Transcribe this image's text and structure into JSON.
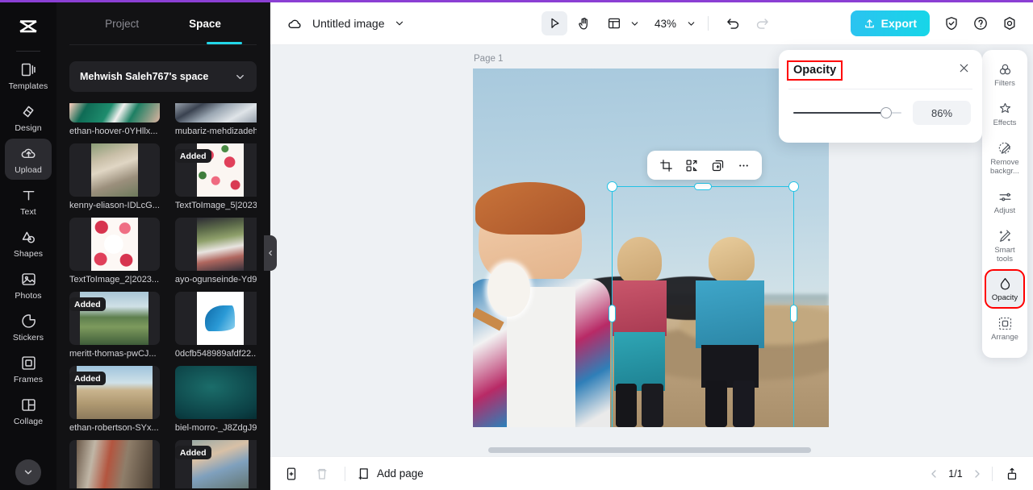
{
  "app": {
    "logo": "capcut-logo",
    "accent": "#23d6e8",
    "highlight": "#ff0000"
  },
  "left_rail": {
    "items": [
      {
        "label": "Templates",
        "icon": "templates-icon",
        "active": false
      },
      {
        "label": "Design",
        "icon": "design-icon",
        "active": false
      },
      {
        "label": "Upload",
        "icon": "upload-cloud-icon",
        "active": true
      },
      {
        "label": "Text",
        "icon": "text-icon",
        "active": false
      },
      {
        "label": "Shapes",
        "icon": "shapes-icon",
        "active": false
      },
      {
        "label": "Photos",
        "icon": "photos-icon",
        "active": false
      },
      {
        "label": "Stickers",
        "icon": "stickers-icon",
        "active": false
      },
      {
        "label": "Frames",
        "icon": "frames-icon",
        "active": false
      },
      {
        "label": "Collage",
        "icon": "collage-icon",
        "active": false
      }
    ],
    "collapse_icon": "chevron-down-icon"
  },
  "panel": {
    "tabs": [
      {
        "label": "Project",
        "active": false
      },
      {
        "label": "Space",
        "active": true
      }
    ],
    "space_select": {
      "value": "Mehwish Saleh767's space",
      "icon": "chevron-down-icon"
    },
    "collapse_icon": "chevron-left-icon",
    "assets": [
      {
        "name": "ethan-hoover-0YHllx...",
        "badge": ""
      },
      {
        "name": "mubariz-mehdizadeh...",
        "badge": ""
      },
      {
        "name": "kenny-eliason-IDLcG...",
        "badge": ""
      },
      {
        "name": "TextToImage_5|2023...",
        "badge": "Added"
      },
      {
        "name": "TextToImage_2|2023...",
        "badge": ""
      },
      {
        "name": "ayo-ogunseinde-Yd9...",
        "badge": ""
      },
      {
        "name": "meritt-thomas-pwCJ...",
        "badge": "Added"
      },
      {
        "name": "0dcfb548989afdf22...",
        "badge": ""
      },
      {
        "name": "ethan-robertson-SYx...",
        "badge": "Added"
      },
      {
        "name": "biel-morro-_J8ZdgJ9...",
        "badge": ""
      },
      {
        "name": "",
        "badge": ""
      },
      {
        "name": "",
        "badge": "Added"
      }
    ]
  },
  "topbar": {
    "cloud_icon": "cloud-icon",
    "doc_title": "Untitled image",
    "title_caret": "chevron-down-icon",
    "tools": [
      {
        "name": "select-tool",
        "icon": "cursor-arrow-icon",
        "selected": true
      },
      {
        "name": "hand-tool",
        "icon": "hand-icon",
        "selected": false
      },
      {
        "name": "layout-tool",
        "icon": "layout-icon",
        "selected": false
      }
    ],
    "zoom": "43%",
    "zoom_caret": "chevron-down-icon",
    "undo_icon": "undo-icon",
    "redo_icon": "redo-icon",
    "export_label": "Export",
    "export_icon": "upload-icon",
    "shield_icon": "shield-check-icon",
    "help_icon": "question-circle-icon",
    "settings_icon": "gear-icon"
  },
  "canvas": {
    "page_label": "Page 1",
    "float_toolbar": [
      {
        "name": "crop-button",
        "icon": "crop-icon"
      },
      {
        "name": "flip-button",
        "icon": "flip-icon"
      },
      {
        "name": "duplicate-button",
        "icon": "duplicate-icon"
      },
      {
        "name": "more-button",
        "icon": "ellipsis-icon"
      }
    ],
    "rotate_icon": "rotate-icon"
  },
  "opacity_popover": {
    "title": "Opacity",
    "close_icon": "close-icon",
    "value": "86%",
    "percent": 86
  },
  "tools_rail": [
    {
      "label": "Filters",
      "icon": "filters-icon",
      "active": false,
      "highlight": false
    },
    {
      "label": "Effects",
      "icon": "effects-icon",
      "active": false,
      "highlight": false
    },
    {
      "label": "Remove backgr...",
      "icon": "remove-background-icon",
      "active": false,
      "highlight": false
    },
    {
      "label": "Adjust",
      "icon": "adjust-icon",
      "active": false,
      "highlight": false
    },
    {
      "label": "Smart tools",
      "icon": "smart-tools-icon",
      "active": false,
      "highlight": false
    },
    {
      "label": "Opacity",
      "icon": "opacity-drop-icon",
      "active": true,
      "highlight": true
    },
    {
      "label": "Arrange",
      "icon": "arrange-icon",
      "active": false,
      "highlight": false
    }
  ],
  "bottombar": {
    "duplicate_page_icon": "duplicate-page-icon",
    "delete_page_icon": "trash-icon",
    "add_page_icon": "add-page-icon",
    "add_page_label": "Add page",
    "prev_icon": "chevron-left-icon",
    "page_indicator": "1/1",
    "next_icon": "chevron-right-icon",
    "export_page_icon": "export-page-icon"
  }
}
